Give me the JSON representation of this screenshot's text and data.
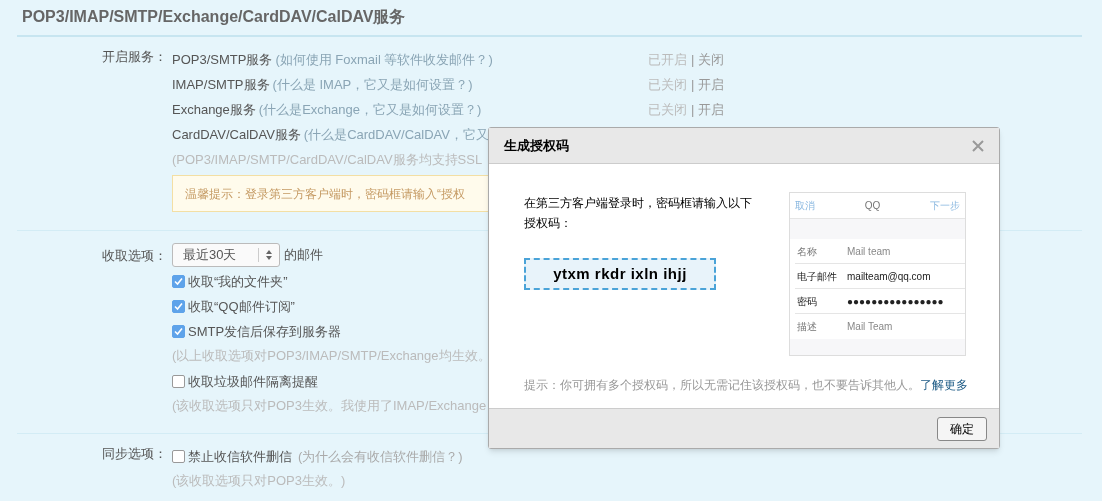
{
  "section_title": "POP3/IMAP/SMTP/Exchange/CardDAV/CalDAV服务",
  "services": {
    "label": "开启服务：",
    "items": [
      {
        "name": "POP3/SMTP服务",
        "help": "(如何使用 Foxmail 等软件收发邮件？)",
        "status": "已开启",
        "separator": "|",
        "action": "关闭"
      },
      {
        "name": "IMAP/SMTP服务",
        "help": "(什么是 IMAP，它又是如何设置？)",
        "status": "已关闭",
        "separator": "|",
        "action": "开启"
      },
      {
        "name": "Exchange服务",
        "help": "(什么是Exchange，它又是如何设置？)",
        "status": "已关闭",
        "separator": "|",
        "action": "开启"
      },
      {
        "name": "CardDAV/CalDAV服务",
        "help": "(什么是CardDAV/CalDAV，它又"
      }
    ],
    "note": "(POP3/IMAP/SMTP/CardDAV/CalDAV服务均支持SSL",
    "tip": "温馨提示：登录第三方客户端时，密码框请输入“授权"
  },
  "receive": {
    "label": "收取选项：",
    "select": {
      "value": "最近30天",
      "suffix": "的邮件"
    },
    "options": [
      {
        "kind": "checkbox",
        "label": "收取“我的文件夹”",
        "checked": true
      },
      {
        "kind": "checkbox",
        "label": "收取“QQ邮件订阅”",
        "checked": true
      },
      {
        "kind": "checkbox",
        "label": "SMTP发信后保存到服务器",
        "checked": true
      },
      {
        "kind": "note",
        "label": "(以上收取选项对POP3/IMAP/SMTP/Exchange均生效。"
      },
      {
        "kind": "checkbox",
        "label": "收取垃圾邮件隔离提醒",
        "checked": false
      },
      {
        "kind": "note",
        "label": "(该收取选项只对POP3生效。我使用了IMAP/Exchange"
      }
    ]
  },
  "sync": {
    "label": "同步选项：",
    "options": [
      {
        "kind": "checkbox",
        "label": "禁止收信软件删信",
        "help": "(为什么会有收信软件删信？)",
        "checked": false
      },
      {
        "kind": "note",
        "label": "(该收取选项只对POP3生效。)"
      }
    ]
  },
  "dialog": {
    "title": "生成授权码",
    "message": "在第三方客户端登录时，密码框请输入以下授权码：",
    "code": "ytxm rkdr ixln ihjj",
    "phone": {
      "cancel": "取消",
      "title": "QQ",
      "next": "下一步",
      "rows": [
        {
          "label": "名称",
          "value": "Mail team",
          "kind": "placeholder"
        },
        {
          "label": "电子邮件",
          "value": "mailteam@qq.com",
          "kind": "filled"
        },
        {
          "label": "密码",
          "value": "●●●●●●●●●●●●●●●●",
          "kind": "filled"
        },
        {
          "label": "描述",
          "value": "Mail Team",
          "kind": "placeholder"
        }
      ]
    },
    "hint": "提示：你可拥有多个授权码，所以无需记住该授权码，也不要告诉其他人。",
    "link": "了解更多",
    "ok": "确定"
  }
}
